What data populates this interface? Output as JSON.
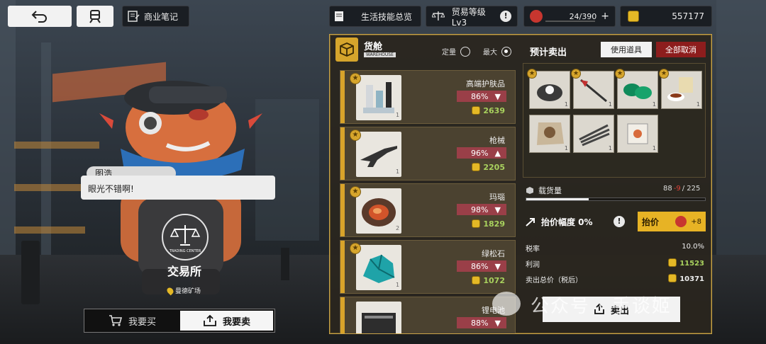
{
  "topbar": {
    "notes_label": "商业笔记",
    "life_skills_label": "生活技能总览",
    "trade_level_label": "贸易等级Lv3",
    "stamina_value": "24/390",
    "currency_value": "557177"
  },
  "character": {
    "speaker_name": "图浩",
    "dialog_text": "眼光不错啊!",
    "place_title": "交易所",
    "location_name": "曼德矿场",
    "emblem_text": "TRADING CENTER"
  },
  "trade_tabs": {
    "buy_label": "我要买",
    "sell_label": "我要卖"
  },
  "warehouse": {
    "badge_label": "WAREHOUSE",
    "title": "货舱",
    "subtitle": "WAREHOUSE",
    "mode_fixed_label": "定量",
    "mode_max_label": "最大",
    "selected_mode": "最大"
  },
  "goods": [
    {
      "name": "高端护肤品",
      "percent": "86%",
      "trend": "▼",
      "price": "2639",
      "qty": "1"
    },
    {
      "name": "枪械",
      "percent": "96%",
      "trend": "▲",
      "price": "2205",
      "qty": "1"
    },
    {
      "name": "玛瑙",
      "percent": "98%",
      "trend": "▼",
      "price": "1829",
      "qty": "2"
    },
    {
      "name": "绿松石",
      "percent": "86%",
      "trend": "▼",
      "price": "1072",
      "qty": "1"
    },
    {
      "name": "锂电池",
      "percent": "88%",
      "trend": "▼",
      "price": "",
      "qty": ""
    }
  ],
  "sale": {
    "title": "预计卖出",
    "use_item_label": "使用道具",
    "cancel_all_label": "全部取消",
    "slots": [
      {
        "item": "pearl",
        "qty": "1"
      },
      {
        "item": "tool",
        "qty": "1"
      },
      {
        "item": "jade",
        "qty": "1"
      },
      {
        "item": "tea",
        "qty": "1"
      },
      {
        "item": "fur",
        "qty": "1"
      },
      {
        "item": "feather",
        "qty": "1"
      },
      {
        "item": "box",
        "qty": "1"
      }
    ],
    "capacity_label": "载货量",
    "capacity_used": "88",
    "capacity_minus": "-9",
    "capacity_total": "/ 225",
    "capacity_fraction": 0.35,
    "raise_label": "抬价幅度 0%",
    "raise_button_label": "抬价",
    "raise_cost": "+8",
    "tax_label": "税率",
    "tax_value": "10.0%",
    "profit_label": "利润",
    "profit_value": "11523",
    "total_label": "卖出总价（税后）",
    "total_value": "10371",
    "sell_button_label": "卖出"
  },
  "watermark_text": "公众号 · 手谈姬",
  "colors": {
    "gold": "#d6a52c",
    "panel_border": "#c9a44a",
    "percent_bg": "#9a3f48",
    "price_green": "#a9d25e",
    "cancel_red": "#8d1d1d"
  }
}
